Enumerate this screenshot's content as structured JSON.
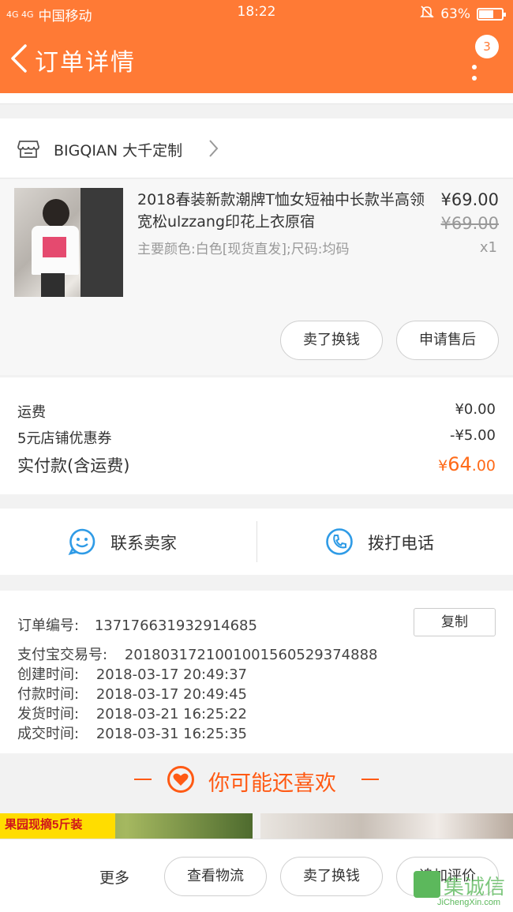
{
  "status_bar": {
    "signal": "4G 4G",
    "carrier": "中国移动",
    "time": "18:22",
    "battery": "63%",
    "battery_level": 0.63
  },
  "header": {
    "title": "订单详情",
    "badge": "3"
  },
  "shop": {
    "name": "BIGQIAN 大千定制"
  },
  "product": {
    "title": "2018春装新款潮牌T恤女短袖中长款半高领宽松ulzzang印花上衣原宿",
    "spec": "主要颜色:白色[现货直发];尺码:均码",
    "price": "¥69.00",
    "original_price": "¥69.00",
    "quantity": "x1",
    "buttons": [
      "卖了换钱",
      "申请售后"
    ]
  },
  "fees": {
    "shipping_label": "运费",
    "shipping_value": "¥0.00",
    "coupon_label": "5元店铺优惠券",
    "coupon_value": "-¥5.00",
    "total_label": "实付款(含运费)",
    "total_prefix": "¥",
    "total_int": "64",
    "total_dec": ".00"
  },
  "contact": {
    "seller": "联系卖家",
    "phone": "拨打电话"
  },
  "order_info": {
    "order_no_label": "订单编号:",
    "order_no": "13717663193​2914685",
    "copy_label": "复制",
    "alipay_label": "支付宝交易号:",
    "alipay_no": "2018031721001001560529374888",
    "created_label": "创建时间:",
    "created": "2018-03-17 20:49:37",
    "paid_label": "付款时间:",
    "paid": "2018-03-17 20:49:45",
    "shipped_label": "发货时间:",
    "shipped": "2018-03-21 16:25:22",
    "completed_label": "成交时间:",
    "completed": "2018-03-31 16:25:35"
  },
  "recommend": {
    "title": "你可能还喜欢",
    "tile1_tag": "果园现摘5斤装"
  },
  "bottom_bar": {
    "more": "更多",
    "logistics": "查看物流",
    "resell": "卖了换钱",
    "review": "追加评价"
  },
  "watermark": {
    "text": "集诚信",
    "url": "JiChengXin.com"
  },
  "colors": {
    "accent": "#ff7a35",
    "price_orange": "#ff6a18",
    "icon_blue": "#2f9be6"
  }
}
